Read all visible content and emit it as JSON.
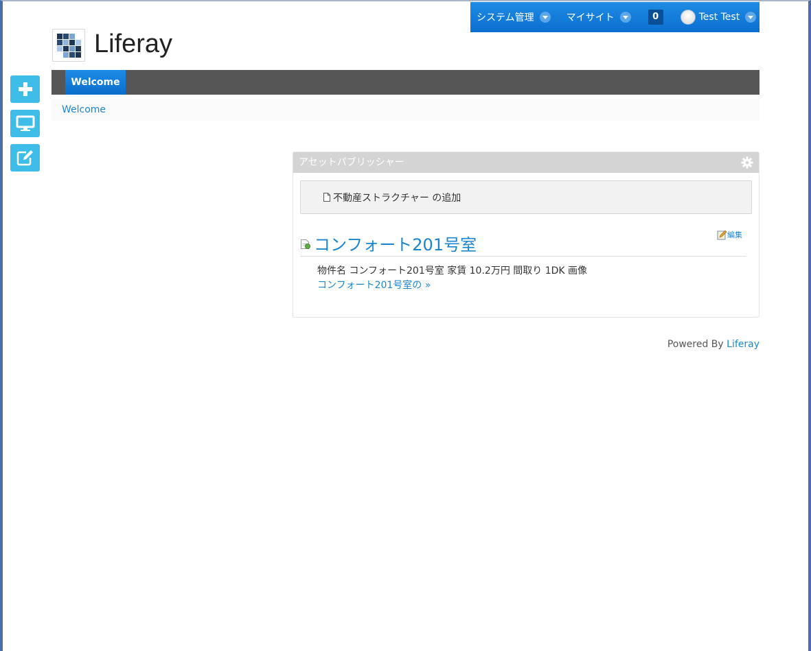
{
  "dockbar": {
    "admin_label": "システム管理",
    "mysites_label": "マイサイト",
    "notifications_count": "0",
    "user_name": "Test Test"
  },
  "site": {
    "title": "Liferay"
  },
  "nav": {
    "tabs": [
      {
        "label": "Welcome"
      }
    ]
  },
  "breadcrumb": {
    "items": [
      {
        "label": "Welcome"
      }
    ]
  },
  "left_toolbar": {
    "icons": [
      "add-icon",
      "preview-icon",
      "edit-controls-icon"
    ]
  },
  "portlet": {
    "title": "アセットパブリッシャー",
    "add_label": "不動産ストラクチャー の追加",
    "edit_label": "編集",
    "asset": {
      "title": "コンフォート201号室",
      "summary": "物件名 コンフォート201号室 家賃 10.2万円 間取り 1DK 画像",
      "read_more": "コンフォート201号室の »"
    }
  },
  "footer": {
    "powered_by": "Powered By",
    "link": "Liferay"
  },
  "colors": {
    "accent": "#1a86d0",
    "dockbar": "#0b6fd0",
    "tool_button": "#3fbde9",
    "nav_bg": "#565656"
  }
}
